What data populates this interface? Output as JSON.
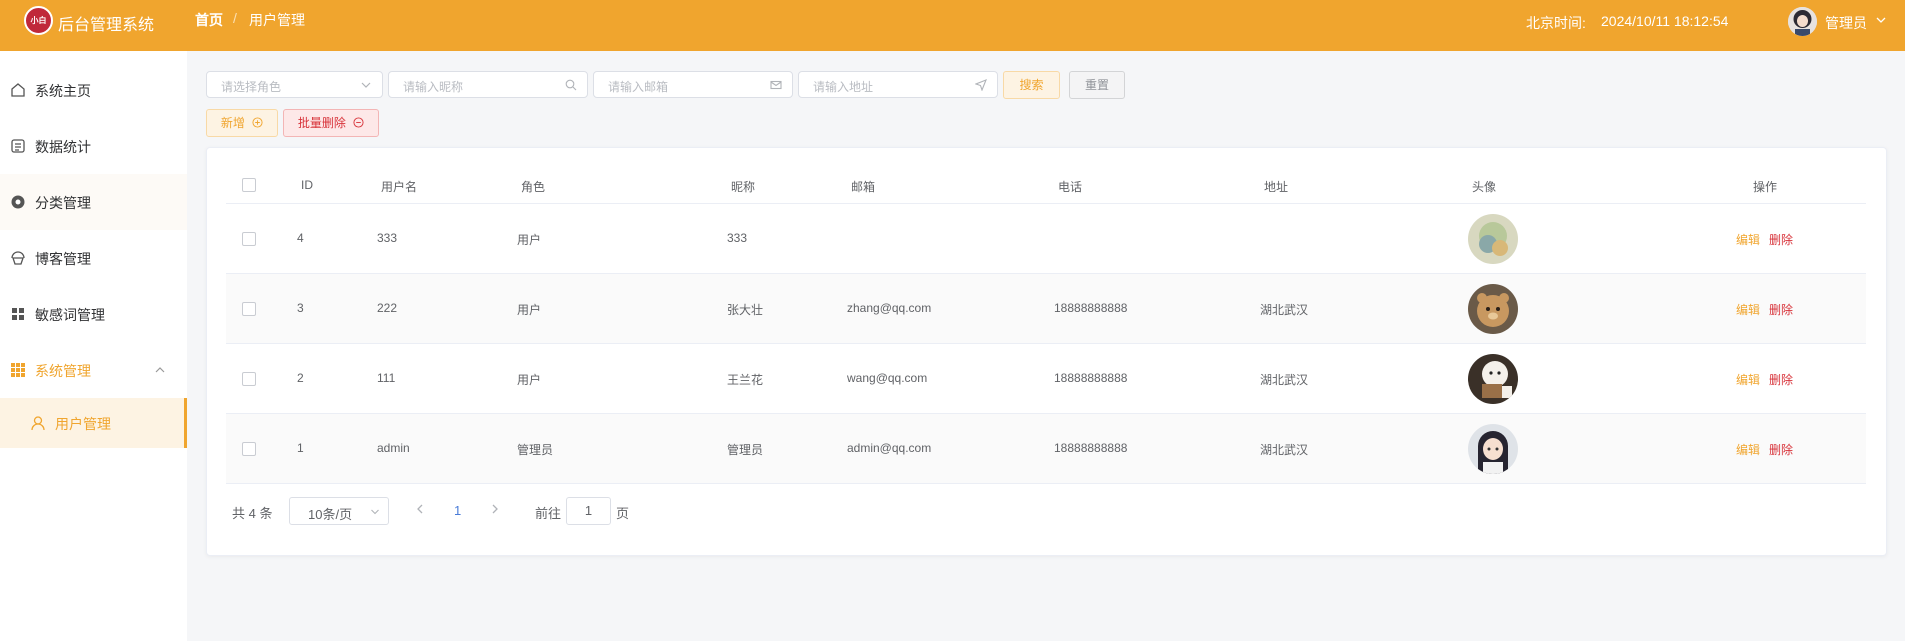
{
  "header": {
    "logo_text": "小白",
    "app_title": "后台管理系统",
    "breadcrumb": {
      "home": "首页",
      "separator": "/",
      "current": "用户管理"
    },
    "clock_label": "北京时间:",
    "clock_value": "2024/10/11 18:12:54",
    "user_name": "管理员",
    "accent_color": "#f0a52e"
  },
  "sidebar": {
    "items": [
      {
        "label": "系统主页",
        "icon": "home-icon"
      },
      {
        "label": "数据统计",
        "icon": "chart-icon"
      },
      {
        "label": "分类管理",
        "icon": "category-icon"
      },
      {
        "label": "博客管理",
        "icon": "blog-icon"
      },
      {
        "label": "敏感词管理",
        "icon": "grid-icon"
      },
      {
        "label": "系统管理",
        "icon": "apps-icon",
        "expanded": true
      }
    ],
    "sub_item": {
      "label": "用户管理",
      "icon": "user-icon"
    }
  },
  "toolbar": {
    "role_placeholder": "请选择角色",
    "nickname_placeholder": "请输入昵称",
    "email_placeholder": "请输入邮箱",
    "address_placeholder": "请输入地址",
    "search_label": "搜索",
    "reset_label": "重置",
    "add_label": "新增",
    "batch_delete_label": "批量删除"
  },
  "table": {
    "columns": [
      "ID",
      "用户名",
      "角色",
      "昵称",
      "邮箱",
      "电话",
      "地址",
      "头像",
      "操作"
    ],
    "edit_label": "编辑",
    "delete_label": "删除",
    "rows": [
      {
        "id": "4",
        "username": "333",
        "role": "用户",
        "nickname": "333",
        "email": "",
        "phone": "",
        "address": ""
      },
      {
        "id": "3",
        "username": "222",
        "role": "用户",
        "nickname": "张大壮",
        "email": "zhang@qq.com",
        "phone": "18888888888",
        "address": "湖北武汉"
      },
      {
        "id": "2",
        "username": "111",
        "role": "用户",
        "nickname": "王兰花",
        "email": "wang@qq.com",
        "phone": "18888888888",
        "address": "湖北武汉"
      },
      {
        "id": "1",
        "username": "admin",
        "role": "管理员",
        "nickname": "管理员",
        "email": "admin@qq.com",
        "phone": "18888888888",
        "address": "湖北武汉"
      }
    ]
  },
  "pagination": {
    "total_text": "共 4 条",
    "page_size": "10条/页",
    "current_page": "1",
    "goto_label": "前往",
    "goto_value": "1",
    "goto_unit": "页"
  }
}
